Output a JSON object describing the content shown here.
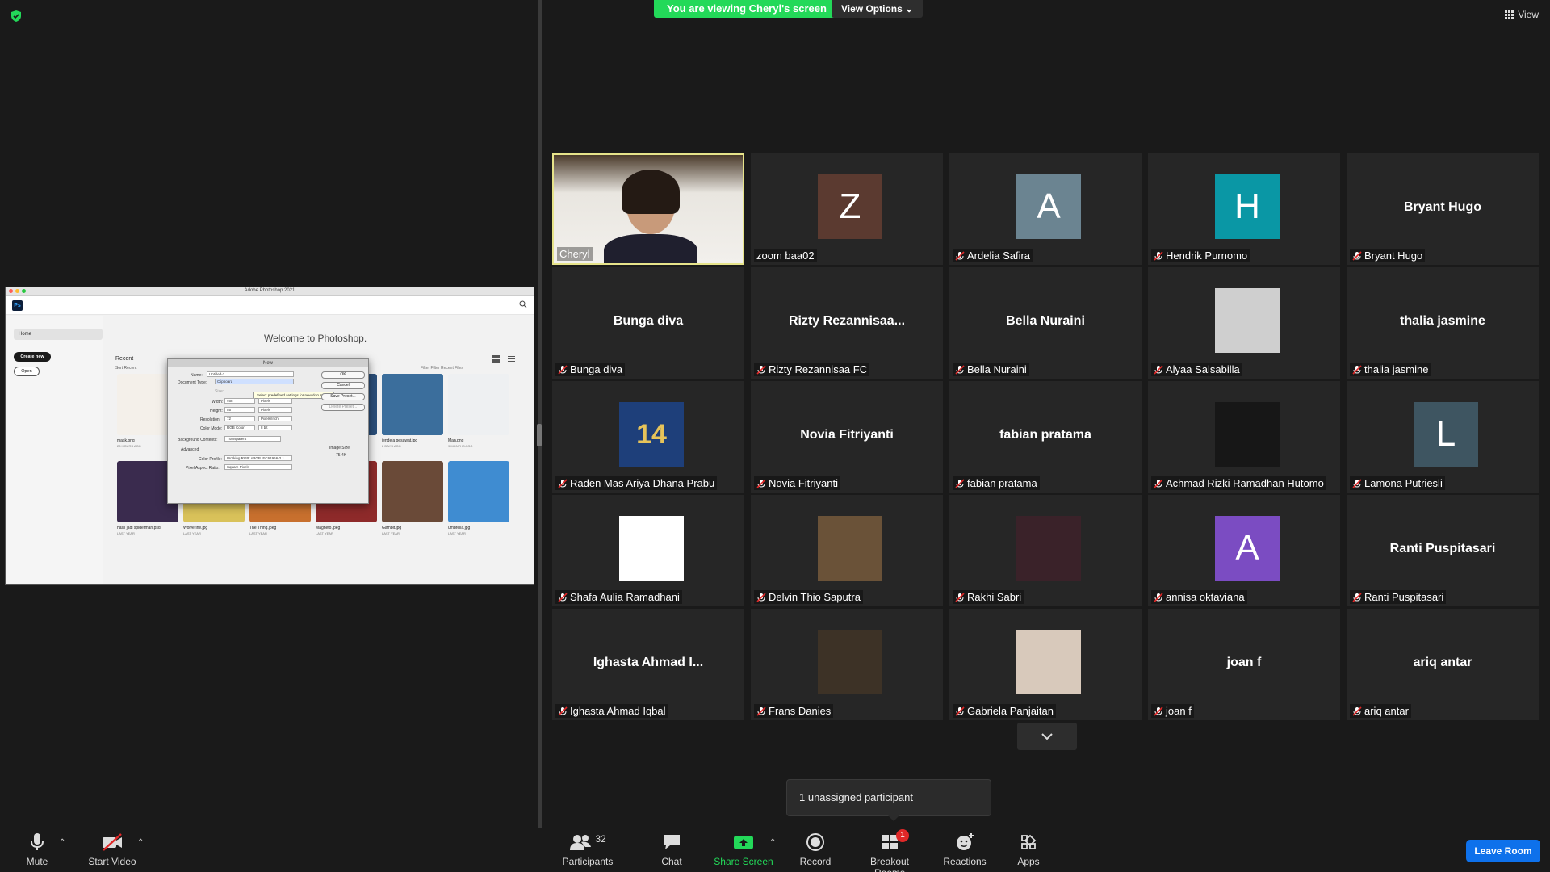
{
  "meeting": {
    "banner": "You are viewing Cheryl's screen",
    "view_options": "View Options",
    "view_button": "View",
    "unassigned": "1 unassigned participant"
  },
  "shared_screen": {
    "window_title": "Adobe Photoshop 2021",
    "logo": "Ps",
    "welcome": "Welcome to Photoshop.",
    "home": "Home",
    "create_new": "Create new",
    "open": "Open",
    "recent": "Recent",
    "sort": "Sort  Recent",
    "filter": "Filter   Filter Recent Files",
    "files": [
      {
        "name": "mask.png",
        "time": "23 HOURS AGO",
        "color": "#f4f0ea"
      },
      {
        "name": "",
        "time": "",
        "color": "#ececec"
      },
      {
        "name": "",
        "time": "",
        "color": "#ececec"
      },
      {
        "name": "",
        "time": "",
        "color": "#2a4f7a"
      },
      {
        "name": "jendela pesawat.jpg",
        "time": "2 DAYS AGO",
        "color": "#3b6e9c"
      },
      {
        "name": "Man.png",
        "time": "9 MONTHS AGO",
        "color": "#eef0f2"
      },
      {
        "name": "hasil jadi spiderman.psd",
        "time": "LAST YEAR",
        "color": "#3a2b4e"
      },
      {
        "name": "Wolverine.jpg",
        "time": "LAST YEAR",
        "color": "#d9c25a"
      },
      {
        "name": "The Thing.jpeg",
        "time": "LAST YEAR",
        "color": "#c8702e"
      },
      {
        "name": "Magneto.jpeg",
        "time": "LAST YEAR",
        "color": "#8e2a2a"
      },
      {
        "name": "Gambit.jpg",
        "time": "LAST YEAR",
        "color": "#6a4a38"
      },
      {
        "name": "umbrella.jpg",
        "time": "LAST YEAR",
        "color": "#3f8cd1"
      }
    ],
    "dialog": {
      "title": "New",
      "name_label": "Name:",
      "name_value": "Untitled-1",
      "doctype_label": "Document Type:",
      "doctype_value": "Clipboard",
      "tooltip": "Select predefined settings for new documents.",
      "size_label": "Size:",
      "width_label": "Width:",
      "width_value": "468",
      "width_unit": "Pixels",
      "height_label": "Height:",
      "height_value": "55",
      "height_unit": "Pixels",
      "res_label": "Resolution:",
      "res_value": "72",
      "res_unit": "Pixels/Inch",
      "mode_label": "Color Mode:",
      "mode_value": "RGB Color",
      "mode_bits": "8 bit",
      "bg_label": "Background Contents:",
      "bg_value": "Transparent",
      "advanced": "Advanced",
      "profile_label": "Color Profile:",
      "profile_value": "Working RGB: sRGB IEC61966-2.1",
      "aspect_label": "Pixel Aspect Ratio:",
      "aspect_value": "Square Pixels",
      "ok": "OK",
      "cancel": "Cancel",
      "save_preset": "Save Preset...",
      "delete_preset": "Delete Preset...",
      "image_size_label": "Image Size:",
      "image_size_value": "75,4K"
    }
  },
  "participants": [
    {
      "name": "Cheryl",
      "display": "",
      "type": "video",
      "muted": false,
      "active": true
    },
    {
      "name": "zoom baa02",
      "display": "Z",
      "type": "avatar",
      "color": "#5b3a30",
      "muted": false
    },
    {
      "name": "Ardelia Safira",
      "display": "A",
      "type": "avatar",
      "color": "#6b8491",
      "muted": true
    },
    {
      "name": "Hendrik Purnomo",
      "display": "H",
      "type": "avatar",
      "color": "#0a97a5",
      "muted": true
    },
    {
      "name": "Bryant Hugo",
      "display": "Bryant Hugo",
      "type": "text",
      "muted": true
    },
    {
      "name": "Bunga diva",
      "display": "Bunga diva",
      "type": "text",
      "muted": true
    },
    {
      "name": "Rizty Rezannisaa FC",
      "display": "Rizty  Rezannisaa...",
      "type": "text",
      "muted": true
    },
    {
      "name": "Bella Nuraini",
      "display": "Bella Nuraini",
      "type": "text",
      "muted": true
    },
    {
      "name": "Alyaa Salsabilla",
      "display": "",
      "type": "photo",
      "color": "#cfcfcf",
      "muted": true
    },
    {
      "name": "thalia jasmine",
      "display": "thalia jasmine",
      "type": "text",
      "muted": true
    },
    {
      "name": "Raden Mas Ariya Dhana Prabu",
      "display": "14",
      "type": "photo",
      "color": "#1e3f7a",
      "muted": true
    },
    {
      "name": "Novia Fitriyanti",
      "display": "Novia Fitriyanti",
      "type": "text",
      "muted": true
    },
    {
      "name": "fabian pratama",
      "display": "fabian pratama",
      "type": "text",
      "muted": true
    },
    {
      "name": "Achmad Rizki Ramadhan Hutomo",
      "display": "",
      "type": "photo",
      "color": "#171717",
      "muted": true
    },
    {
      "name": "Lamona Putriesli",
      "display": "L",
      "type": "avatar",
      "color": "#3e5561",
      "muted": true
    },
    {
      "name": "Shafa Aulia Ramadhani",
      "display": "",
      "type": "photo",
      "color": "#ffffff",
      "muted": true
    },
    {
      "name": "Delvin Thio Saputra",
      "display": "",
      "type": "photo",
      "color": "#6a5238",
      "muted": true
    },
    {
      "name": "Rakhi Sabri",
      "display": "",
      "type": "photo",
      "color": "#3a2229",
      "muted": true
    },
    {
      "name": "annisa oktaviana",
      "display": "A",
      "type": "avatar",
      "color": "#7b4cc2",
      "muted": true
    },
    {
      "name": "Ranti Puspitasari",
      "display": "Ranti Puspitasari",
      "type": "text",
      "muted": true
    },
    {
      "name": "Ighasta Ahmad Iqbal",
      "display": "Ighasta Ahmad I...",
      "type": "text",
      "muted": true
    },
    {
      "name": "Frans Danies",
      "display": "",
      "type": "photo",
      "color": "#3d3226",
      "muted": true
    },
    {
      "name": "Gabriela Panjaitan",
      "display": "",
      "type": "photo",
      "color": "#d8c9bb",
      "muted": true
    },
    {
      "name": "joan f",
      "display": "joan f",
      "type": "text",
      "muted": true
    },
    {
      "name": "ariq antar",
      "display": "ariq antar",
      "type": "text",
      "muted": true
    }
  ],
  "toolbar": {
    "mute": "Mute",
    "start_video": "Start Video",
    "participants": "Participants",
    "participants_count": "32",
    "chat": "Chat",
    "share_screen": "Share Screen",
    "record": "Record",
    "breakout": "Breakout Rooms",
    "breakout_badge": "1",
    "reactions": "Reactions",
    "apps": "Apps",
    "leave": "Leave Room"
  },
  "colors": {
    "banner": "#23d959",
    "share_green": "#23d959",
    "leave_blue": "#0e71eb",
    "mute_red": "#e02828",
    "active_border": "#e6e38a"
  }
}
